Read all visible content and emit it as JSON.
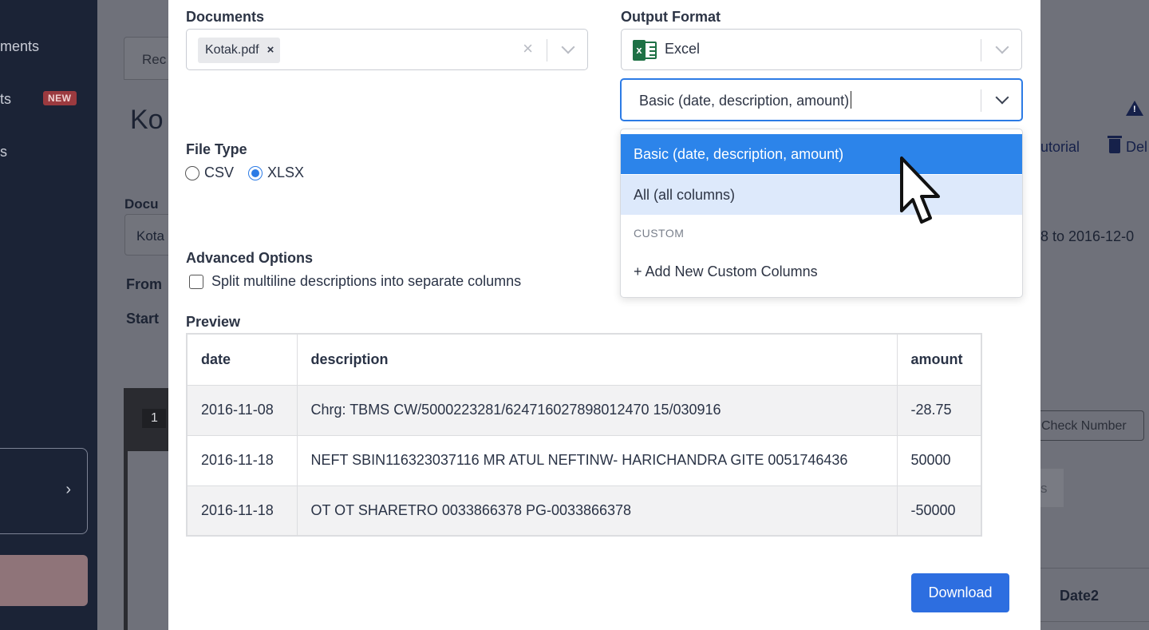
{
  "sidebar": {
    "items": [
      {
        "label": "ments"
      },
      {
        "label": "ts"
      },
      {
        "label": "s"
      }
    ],
    "new_badge": "NEW",
    "card_chevron": "›"
  },
  "background": {
    "tab_label": "Rec",
    "heading_fragment": "Ko",
    "documents_label_fragment": "Docu",
    "documents_input_fragment": "Kota",
    "from_label_fragment": "From",
    "start_label_fragment": "Start",
    "row_number": "1",
    "tutorial_link_fragment": "utorial",
    "delete_link_fragment": "Del",
    "date_range_fragment": "8 to 2016-12-0",
    "check_number_button": "Check Number",
    "grey_box_fragment": "s",
    "table_header_date2": "Date2"
  },
  "modal": {
    "documents": {
      "label": "Documents",
      "selected": [
        {
          "name": "Kotak.pdf",
          "remove_glyph": "×"
        }
      ],
      "clear_glyph": "×"
    },
    "output_format": {
      "label": "Output Format",
      "format_value": "Excel",
      "format_icon": "excel-icon",
      "columns_value": "Basic (date, description, amount)",
      "options": [
        {
          "label": "Basic (date, description, amount)",
          "state": "selected"
        },
        {
          "label": "All (all columns)",
          "state": "hover"
        }
      ],
      "custom_group_label": "CUSTOM",
      "add_custom_label": "+ Add New Custom Columns"
    },
    "file_type": {
      "label": "File Type",
      "options": [
        {
          "label": "CSV",
          "checked": false
        },
        {
          "label": "XLSX",
          "checked": true
        }
      ]
    },
    "advanced": {
      "label": "Advanced Options",
      "split_multiline_label": "Split multiline descriptions into separate columns",
      "split_multiline_checked": false
    },
    "preview": {
      "label": "Preview",
      "columns": [
        "date",
        "description",
        "amount"
      ],
      "rows": [
        [
          "2016-11-08",
          "Chrg: TBMS CW/5000223281/624716027898012470 15/030916",
          "-28.75"
        ],
        [
          "2016-11-18",
          "NEFT SBIN116323037116 MR ATUL NEFTINW- HARICHANDRA GITE 0051746436",
          "50000"
        ],
        [
          "2016-11-18",
          "OT OT SHARETRO 0033866378 PG-0033866378",
          "-50000"
        ]
      ]
    },
    "download_label": "Download"
  },
  "colors": {
    "accent": "#2c84ea",
    "button": "#2d6ee0",
    "option_hover": "#dde9fb",
    "excel_green": "#1e7145",
    "sidebar_bg": "#1b2336"
  }
}
